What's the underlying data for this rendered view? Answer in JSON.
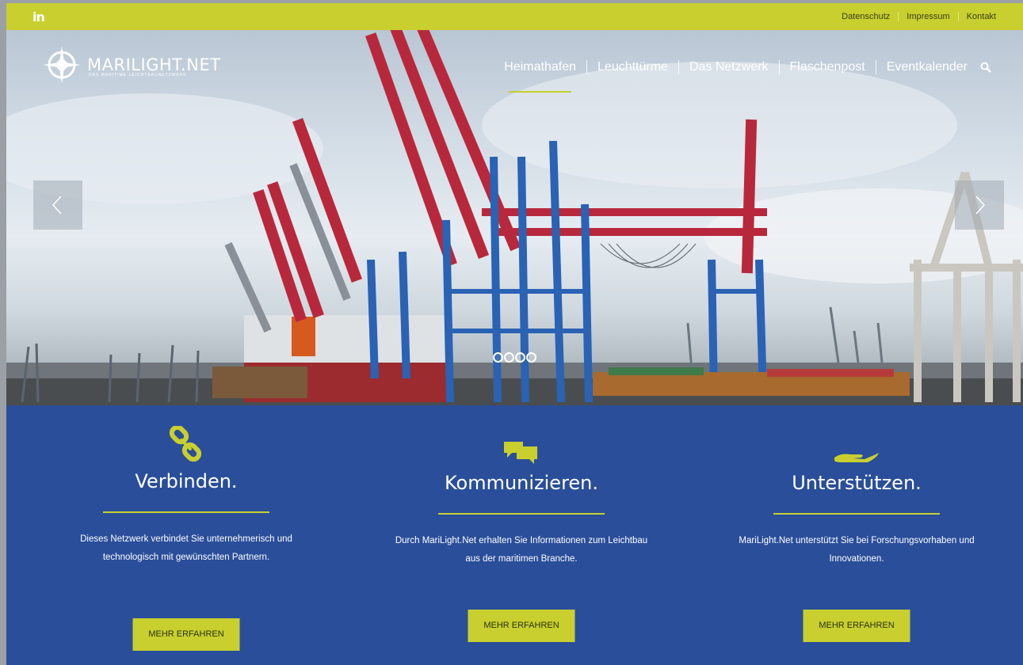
{
  "topbar": {
    "social": "in",
    "links": [
      "Datenschutz",
      "Impressum",
      "Kontakt"
    ]
  },
  "brand": {
    "name": "MARILIGHT.NET",
    "tagline": "DAS MARITIME LEICHTBAUNETZWERK"
  },
  "nav": {
    "items": [
      "Heimathafen",
      "Leuchttürme",
      "Das Netzwerk",
      "Flaschenpost",
      "Eventkalender"
    ],
    "active_index": 0
  },
  "slider": {
    "dots": 4,
    "active_dot": 0
  },
  "features": [
    {
      "icon": "link-icon",
      "title": "Verbinden.",
      "text_lines": [
        "Dieses Netzwerk verbindet Sie unternehmerisch und",
        "technologisch mit gewünschten Partnern."
      ],
      "button": "MEHR ERFAHREN"
    },
    {
      "icon": "chat-icon",
      "title": "Kommunizieren.",
      "text_lines": [
        "Durch MariLight.Net erhalten Sie Informationen zum Leichtbau",
        "aus der maritimen Branche."
      ],
      "button": "MEHR ERFAHREN"
    },
    {
      "icon": "hand-icon",
      "title": "Unterstützen.",
      "text_lines": [
        "MariLight.Net unterstützt Sie bei Forschungsvorhaben und",
        "Innovationen."
      ],
      "button": "MEHR ERFAHREN"
    }
  ],
  "colors": {
    "accent": "#c8cf2e",
    "primary_blue": "#2a4e9a",
    "crane_red": "#b8283c",
    "crane_blue": "#2a62b4"
  }
}
